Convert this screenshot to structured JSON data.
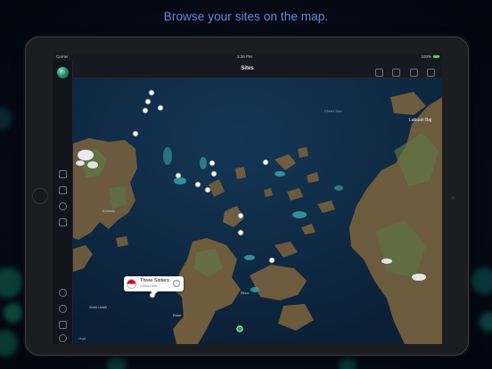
{
  "headline": "Browse your sites on the map.",
  "status_bar": {
    "carrier": "Carrier",
    "time": "3:28 PM",
    "battery": "100%"
  },
  "nav": {
    "title": "Sites"
  },
  "callout": {
    "site_name": "Three Sisters",
    "sub": "1 Dive Here"
  },
  "map_labels": {
    "flores_sea": "Flores Sea",
    "labuan_bajo": "Labuan Baj",
    "komodo": "Komodo",
    "selat_lintah": "Selat Lintah",
    "padar": "Padar",
    "rinca": "Rinca",
    "legal": "Legal"
  },
  "colors": {
    "headline": "#5f8fe0",
    "flag_red": "#d0021b",
    "sea": "#0e2a44",
    "land": "#6c5a3c",
    "reef": "#3aa8b0"
  },
  "icons": {
    "nav": [
      "globe-icon",
      "list-icon",
      "layers-icon",
      "share-icon"
    ],
    "sidebar": [
      "logbook-icon",
      "dive-site-icon",
      "compass-icon",
      "buddies-icon",
      "add-icon",
      "sync-icon",
      "export-icon",
      "settings-icon"
    ]
  }
}
